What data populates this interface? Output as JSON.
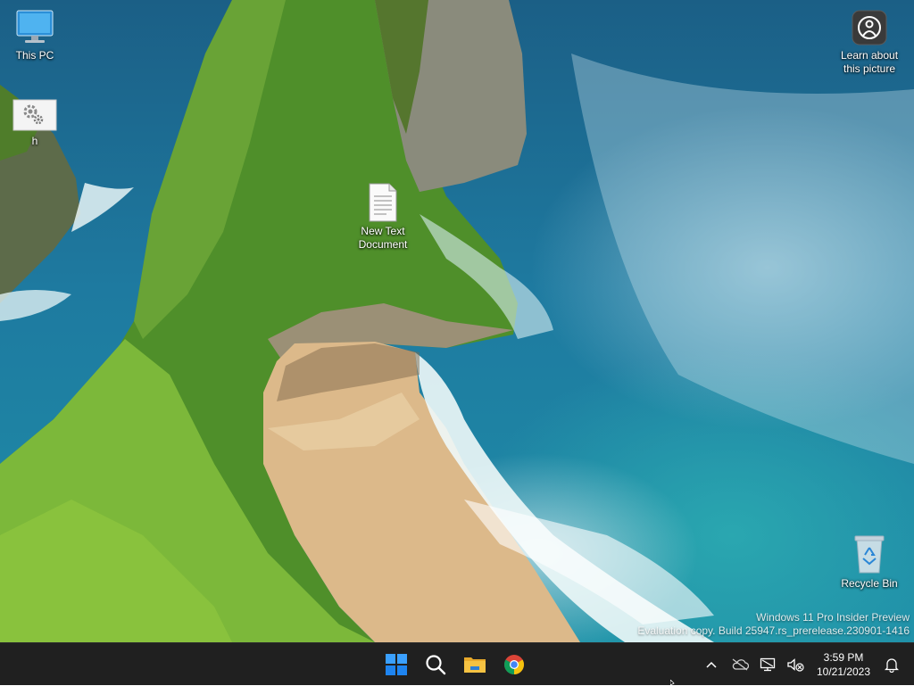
{
  "desktop": {
    "icons": [
      {
        "name": "This PC",
        "icon": "computer-icon"
      },
      {
        "name": "h",
        "icon": "settings-shortcut-icon"
      },
      {
        "name": "New Text\nDocument",
        "icon": "text-document-icon"
      },
      {
        "name": "Learn about\nthis picture",
        "icon": "camera-info-icon"
      },
      {
        "name": "Recycle Bin",
        "icon": "recycle-bin-icon"
      }
    ],
    "watermark": {
      "line1": "Windows 11 Pro Insider Preview",
      "line2": "Evaluation copy. Build 25947.rs_prerelease.230901-1416"
    }
  },
  "taskbar": {
    "pinned": [
      {
        "id": "start",
        "icon": "windows-logo-icon"
      },
      {
        "id": "search",
        "icon": "search-icon"
      },
      {
        "id": "file-explorer",
        "icon": "folder-icon"
      },
      {
        "id": "chrome",
        "icon": "chrome-icon"
      }
    ],
    "tray": {
      "icons": [
        "chevron-up-icon",
        "onedrive-offline-icon",
        "network-disconnected-icon",
        "speaker-muted-icon",
        "notification-bell-icon"
      ],
      "time": "3:59 PM",
      "date": "10/21/2023"
    }
  },
  "colors": {
    "taskbar_bg": "#202020",
    "windows_blue": "#1e90ff",
    "folder_yellow": "#f5c242"
  }
}
